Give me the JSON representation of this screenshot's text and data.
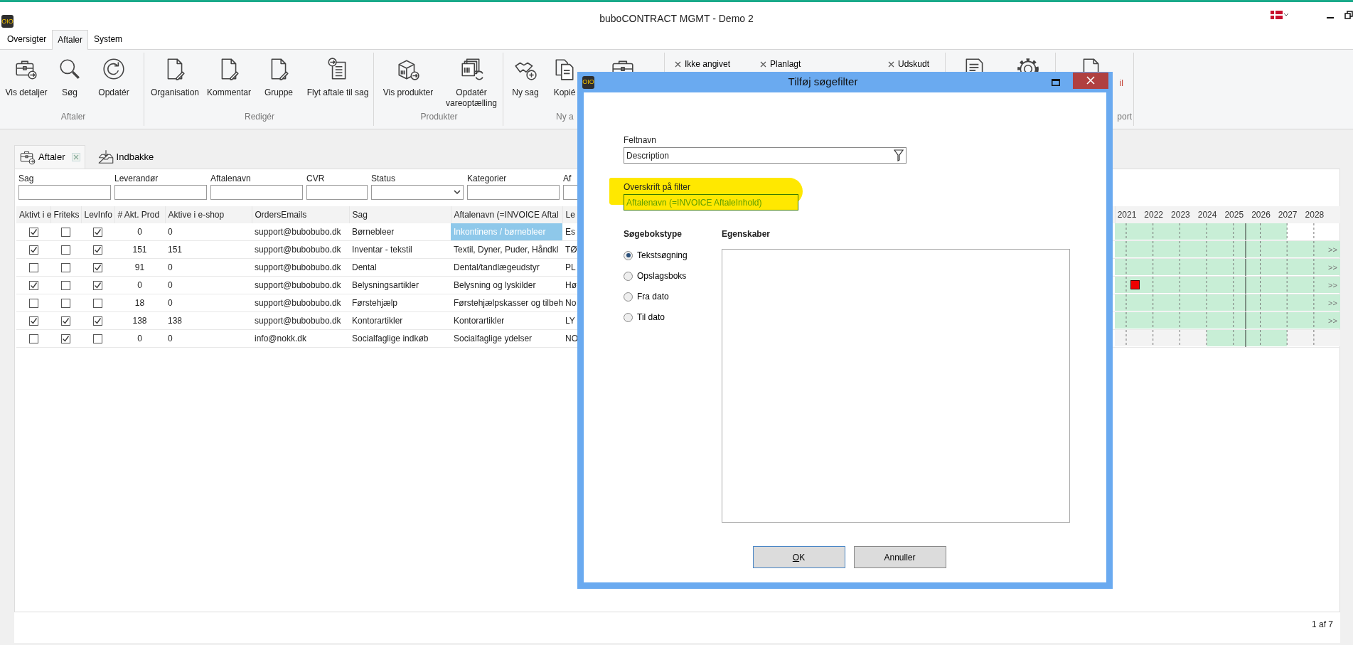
{
  "window": {
    "app_icon": "OIO",
    "title": "buboCONTRACT MGMT - Demo 2"
  },
  "ribbon_tabs": [
    {
      "label": "Oversigter",
      "selected": false
    },
    {
      "label": "Aftaler",
      "selected": true
    },
    {
      "label": "System",
      "selected": false
    }
  ],
  "ribbon_groups": [
    {
      "kind": "buttons",
      "label": "Aftaler",
      "buttons": [
        {
          "label": "Vis detaljer"
        },
        {
          "label": "Søg"
        },
        {
          "label": "Opdatér"
        }
      ]
    },
    {
      "kind": "buttons",
      "label": "Redigér",
      "buttons": [
        {
          "label": "Organisation"
        },
        {
          "label": "Kommentar"
        },
        {
          "label": "Gruppe"
        },
        {
          "label": "Flyt aftale til sag"
        }
      ]
    },
    {
      "kind": "buttons",
      "label": "Produkter",
      "buttons": [
        {
          "label": "Vis produkter"
        },
        {
          "label": "Opdatér vareoptælling"
        }
      ]
    },
    {
      "kind": "buttons",
      "label": "Ny a",
      "buttons": [
        {
          "label": "Ny sag"
        },
        {
          "label": "Kopié"
        },
        {
          "alert": false
        }
      ]
    },
    {
      "kind": "filters",
      "items": [
        {
          "label": "Ikke angivet"
        },
        {
          "label": "Planlagt"
        },
        {
          "label": "Udskudt"
        }
      ]
    },
    {
      "kind": "buttons",
      "buttons": [
        {
          "alert": false
        },
        {
          "alert": false
        }
      ]
    },
    {
      "kind": "buttons",
      "label": "port",
      "buttons": [
        {
          "label": "il",
          "alert": true
        }
      ]
    }
  ],
  "doc_tabs": [
    {
      "label": "Aftaler",
      "selected": true,
      "closable": true
    },
    {
      "label": "Indbakke",
      "selected": false,
      "closable": false
    }
  ],
  "filters": [
    {
      "label": "Sag",
      "kind": "text"
    },
    {
      "label": "Leverandør",
      "kind": "text"
    },
    {
      "label": "Aftalenavn",
      "kind": "text"
    },
    {
      "label": "CVR",
      "kind": "short"
    },
    {
      "label": "Status",
      "kind": "dropdown"
    },
    {
      "label": "Kategorier",
      "kind": "text"
    },
    {
      "label": "Af",
      "kind": "text"
    }
  ],
  "grid": {
    "columns": [
      "Aktivt i e",
      "Friteks",
      "LevInfo",
      "# Akt. Prod",
      "Aktive i e-shop",
      "OrdersEmails",
      "Sag",
      "Aftalenavn (=INVOICE Aftal",
      "Le"
    ],
    "years": [
      "2021",
      "2022",
      "2023",
      "2024",
      "2025",
      "2026",
      "2027",
      "2028"
    ],
    "rows": [
      {
        "aktivt": true,
        "friteks": false,
        "levinfo": true,
        "akt_prod": "0",
        "aktive_eshop": "0",
        "email": "support@bubobubo.dk",
        "sag": "Børnebleer",
        "aftalenavn": "Inkontinens / børnebleer",
        "selected": true,
        "le": "Es",
        "timeline": {
          "kind": "ending",
          "marker": false
        }
      },
      {
        "aktivt": true,
        "friteks": false,
        "levinfo": true,
        "akt_prod": "151",
        "aktive_eshop": "151",
        "email": "support@bubobubo.dk",
        "sag": "Inventar - tekstil",
        "aftalenavn": "Textil, Dyner, Puder, Håndkl",
        "selected": false,
        "le": "TØ",
        "timeline": {
          "kind": "open",
          "marker": false,
          "more": ">>"
        }
      },
      {
        "aktivt": false,
        "friteks": false,
        "levinfo": true,
        "akt_prod": "91",
        "aktive_eshop": "0",
        "email": "support@bubobubo.dk",
        "sag": "Dental",
        "aftalenavn": "Dental/tandlægeudstyr",
        "selected": false,
        "le": "PL",
        "timeline": {
          "kind": "open",
          "marker": false,
          "more": ">>"
        }
      },
      {
        "aktivt": true,
        "friteks": false,
        "levinfo": true,
        "akt_prod": "0",
        "aktive_eshop": "0",
        "email": "support@bubobubo.dk",
        "sag": "Belysningsartikler",
        "aftalenavn": "Belysning og lyskilder",
        "selected": false,
        "le": "Hø",
        "timeline": {
          "kind": "open",
          "marker": true,
          "more": ">>"
        }
      },
      {
        "aktivt": false,
        "friteks": false,
        "levinfo": false,
        "akt_prod": "18",
        "aktive_eshop": "0",
        "email": "support@bubobubo.dk",
        "sag": "Førstehjælp",
        "aftalenavn": "Førstehjælpskasser og tilbeh",
        "selected": false,
        "le": "No",
        "timeline": {
          "kind": "open",
          "marker": false,
          "more": ">>"
        }
      },
      {
        "aktivt": true,
        "friteks": true,
        "levinfo": true,
        "akt_prod": "138",
        "aktive_eshop": "138",
        "email": "support@bubobubo.dk",
        "sag": "Kontorartikler",
        "aftalenavn": "Kontorartikler",
        "selected": false,
        "le": "LY",
        "timeline": {
          "kind": "open",
          "marker": false,
          "more": ">>"
        }
      },
      {
        "aktivt": false,
        "friteks": true,
        "levinfo": false,
        "akt_prod": "0",
        "aktive_eshop": "0",
        "email": "info@nokk.dk",
        "sag": "Socialfaglige indkøb",
        "aftalenavn": "Socialfaglige ydelser",
        "selected": false,
        "le": "NO",
        "timeline": {
          "kind": "late",
          "marker": false
        }
      }
    ]
  },
  "pager": "1 af 7",
  "dialog": {
    "app_icon": "OIO",
    "title": "Tilføj søgefilter",
    "fields": [
      {
        "label": "Feltnavn",
        "value": "Description",
        "kind": "picker",
        "highlighted": false
      },
      {
        "label": "Overskrift på filter",
        "value": "Aftalenavn (=INVOICE AftaleInhold)",
        "kind": "text",
        "highlighted": true
      }
    ],
    "type_heading": "Søgebokstype",
    "types": [
      {
        "label": "Tekstsøgning",
        "selected": true
      },
      {
        "label": "Opslagsboks",
        "selected": false
      },
      {
        "label": "Fra dato",
        "selected": false
      },
      {
        "label": "Til dato",
        "selected": false
      }
    ],
    "properties_heading": "Egenskaber",
    "buttons": [
      {
        "label": "OK",
        "kind": "default"
      },
      {
        "label": "Annuller",
        "kind": "normal"
      }
    ]
  }
}
